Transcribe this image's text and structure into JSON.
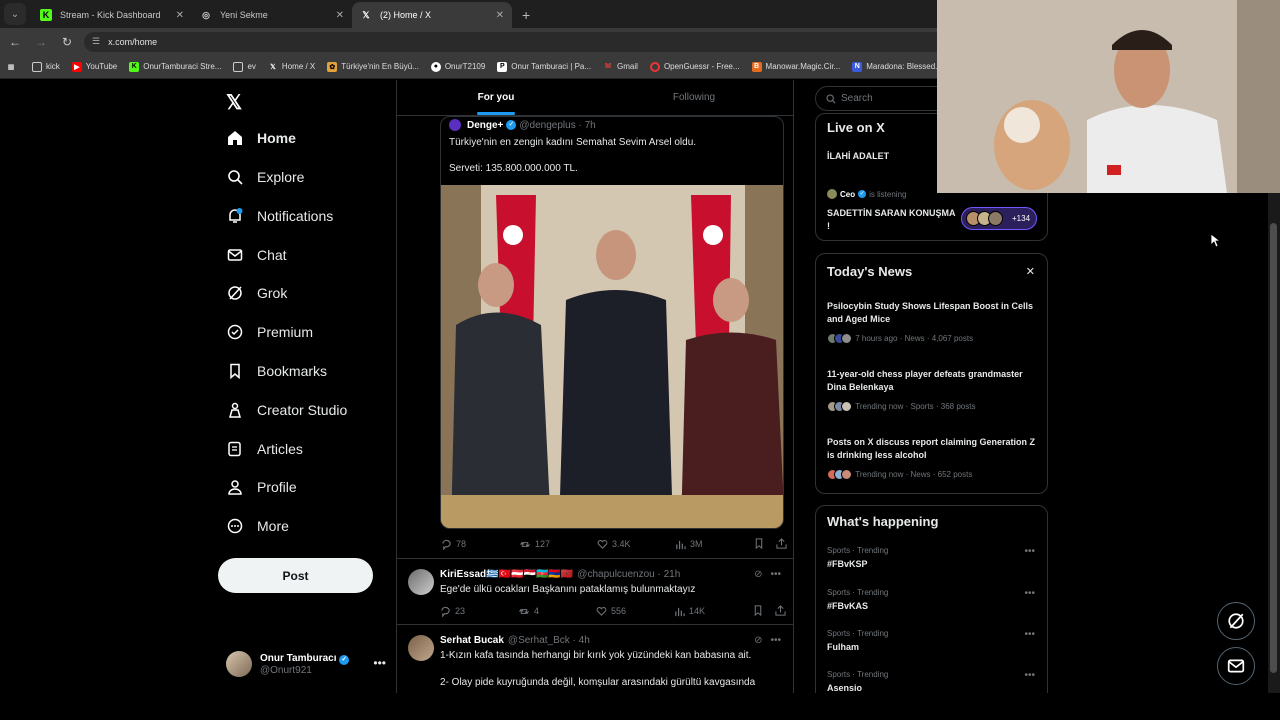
{
  "browser": {
    "tabs": [
      {
        "title": "Stream - Kick Dashboard",
        "icon": "kick-icon",
        "color": "#53fc18"
      },
      {
        "title": "Yeni Sekme",
        "icon": "chrome-icon",
        "color": "#cccccc"
      },
      {
        "title": "(2) Home / X",
        "icon": "x-logo-icon",
        "color": "#ffffff"
      }
    ],
    "url": "x.com/home",
    "bookmarks": [
      {
        "label": "kick",
        "icon": "folder-icon"
      },
      {
        "label": "YouTube",
        "icon": "youtube-icon"
      },
      {
        "label": "OnurTamburaci Stre...",
        "icon": "kick-icon"
      },
      {
        "label": "ev",
        "icon": "folder-icon"
      },
      {
        "label": "Home / X",
        "icon": "x-logo-icon"
      },
      {
        "label": "Türkiye'nin En Büyü...",
        "icon": "site-icon"
      },
      {
        "label": "OnurT2109",
        "icon": "github-icon"
      },
      {
        "label": "Onur Tamburaci | Pa...",
        "icon": "patreon-icon"
      },
      {
        "label": "Gmail",
        "icon": "gmail-icon"
      },
      {
        "label": "OpenGuessr - Free...",
        "icon": "openguessr-icon"
      },
      {
        "label": "Manowar.Magic.Cir...",
        "icon": "bookmark-icon"
      },
      {
        "label": "Maradona: Blessed...",
        "icon": "bookmark-icon"
      }
    ]
  },
  "nav": {
    "items": [
      {
        "label": "Home"
      },
      {
        "label": "Explore"
      },
      {
        "label": "Notifications"
      },
      {
        "label": "Chat"
      },
      {
        "label": "Grok"
      },
      {
        "label": "Premium"
      },
      {
        "label": "Bookmarks"
      },
      {
        "label": "Creator Studio"
      },
      {
        "label": "Articles"
      },
      {
        "label": "Profile"
      },
      {
        "label": "More"
      }
    ],
    "post_label": "Post",
    "account": {
      "name": "Onur Tamburacı",
      "handle": "@Onurt921"
    }
  },
  "feed": {
    "tabs": [
      "For you",
      "Following"
    ],
    "quoted": {
      "name": "Denge+",
      "handle": "@dengeplus",
      "time": "· 7h",
      "text1": "Türkiye'nin en zengin kadını Semahat Sevim Arsel oldu.",
      "text2": "Serveti: 135.800.000.000 TL."
    },
    "main_stats": {
      "replies": "78",
      "reposts": "127",
      "likes": "3.4K",
      "views": "3M"
    },
    "posts": [
      {
        "name": "KiriEssad🇬🇷🇹🇷🇦🇹🇪🇬🇦🇿🇦🇲🇲🇦",
        "handle": "@chapulcuenzou",
        "time": "· 21h",
        "text": "Ege'de ülkü ocakları Başkanını pataklamış bulunmaktayız",
        "replies": "23",
        "reposts": "4",
        "likes": "556",
        "views": "14K"
      },
      {
        "name": "Serhat Bucak",
        "handle": "@Serhat_Bck",
        "time": "· 4h",
        "text1": "1-Kızın kafa tasında herhangi bir kırık yok yüzündeki kan babasına ait.",
        "text2": "2- Olay pide kuyruğunda değil, komşular arasındaki gürültü kavgasında"
      }
    ]
  },
  "right": {
    "search_placeholder": "Search",
    "live": {
      "title": "Live on X",
      "item1": "İLAHİ ADALET",
      "host": "Ceo",
      "listening": "is listening",
      "item2": "SADETTİN SARAN KONUŞMA !",
      "count": "+134"
    },
    "news": {
      "title": "Today's News",
      "items": [
        {
          "title": "Psilocybin Study Shows Lifespan Boost in Cells and Aged Mice",
          "meta": "7 hours ago · News · 4,067 posts"
        },
        {
          "title": "11-year-old chess player defeats grandmaster Dina Belenkaya",
          "meta": "Trending now · Sports · 368 posts"
        },
        {
          "title": "Posts on X discuss report claiming Generation Z is drinking less alcohol",
          "meta": "Trending now · News · 652 posts"
        }
      ]
    },
    "happening": {
      "title": "What's happening",
      "trends": [
        {
          "category": "Sports · Trending",
          "name": "#FBvKSP"
        },
        {
          "category": "Sports · Trending",
          "name": "#FBvKAS"
        },
        {
          "category": "Sports · Trending",
          "name": "Fulham"
        },
        {
          "category": "Sports · Trending",
          "name": "Asensio"
        }
      ]
    }
  },
  "colors": {
    "accent": "#1d9bf0",
    "background": "#000000",
    "border": "#2f3336",
    "muted": "#71767b"
  }
}
